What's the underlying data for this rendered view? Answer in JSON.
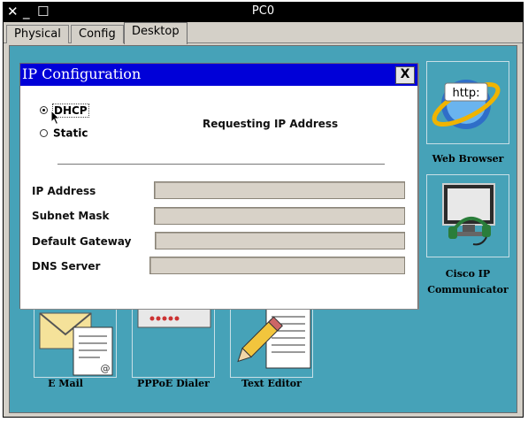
{
  "window": {
    "title": "PC0",
    "controls": {
      "close": "✕",
      "minimize": "_",
      "maximize": "☐"
    }
  },
  "tabs": [
    {
      "label": "Physical",
      "active": false
    },
    {
      "label": "Config",
      "active": false
    },
    {
      "label": "Desktop",
      "active": true
    }
  ],
  "desktop": {
    "apps": {
      "web_browser": {
        "label": "Web Browser",
        "icon": "web-browser-icon",
        "icon_text": "http:"
      },
      "cisco_ip_communicator": {
        "label_line1": "Cisco IP",
        "label_line2": "Communicator",
        "icon": "ip-communicator-icon"
      },
      "email": {
        "label": "E Mail",
        "icon": "email-icon"
      },
      "pppoe_dialer": {
        "label": "PPPoE Dialer",
        "icon": "pppoe-dialer-icon"
      },
      "text_editor": {
        "label": "Text Editor",
        "icon": "text-editor-icon"
      }
    }
  },
  "ip_config": {
    "title": "IP Configuration",
    "close_label": "X",
    "mode": {
      "dhcp_label": "DHCP",
      "static_label": "Static",
      "selected": "DHCP"
    },
    "status": "Requesting IP Address",
    "fields": {
      "ip_address": {
        "label": "IP Address",
        "value": ""
      },
      "subnet_mask": {
        "label": "Subnet Mask",
        "value": ""
      },
      "default_gateway": {
        "label": "Default Gateway",
        "value": ""
      },
      "dns_server": {
        "label": "DNS Server",
        "value": ""
      }
    }
  },
  "colors": {
    "desktop_bg": "#46a2b8",
    "dialog_title_bg": "#0000d8",
    "window_titlebar_bg": "#000000",
    "field_bg": "#d8d2c8"
  }
}
